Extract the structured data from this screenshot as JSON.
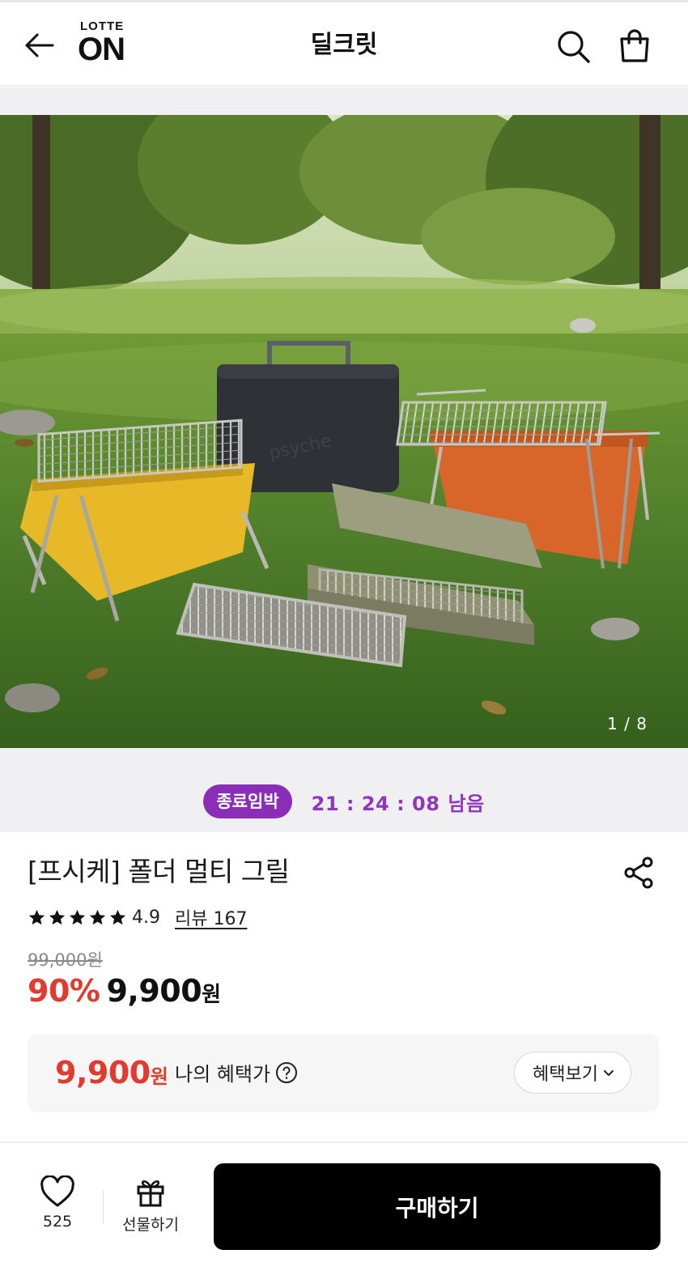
{
  "header": {
    "logo_top": "LOTTE",
    "logo_bottom": "ON",
    "title": "딜크릿",
    "icons": [
      "back-arrow-icon",
      "search-icon",
      "shopping-bag-icon"
    ]
  },
  "hero": {
    "current": "1",
    "total": "8",
    "separator": " / ",
    "colors": {
      "grass": "#4f7d2a",
      "yellow_grill": "#e7b828",
      "orange_grill": "#d8652a",
      "dark_case": "#2e3136",
      "olive_grill": "#8f9070"
    }
  },
  "deal": {
    "badge": "종료임박",
    "timer": "21 : 24 : 08",
    "remain": "남음",
    "color": "#8a2db8"
  },
  "product": {
    "title": "[프시케] 폴더 멀티 그릴",
    "stars": 5,
    "rating": "4.9",
    "review_link": "리뷰 167",
    "original_price": "99,000원",
    "discount": "90%",
    "price": "9,900",
    "price_unit": "원"
  },
  "benefit": {
    "price": "9,900",
    "unit": "원",
    "label": "나의 혜택가",
    "button": "혜택보기",
    "accent": "#e23b2e"
  },
  "bottom": {
    "like_count": "525",
    "gift_label": "선물하기",
    "buy_label": "구매하기"
  }
}
